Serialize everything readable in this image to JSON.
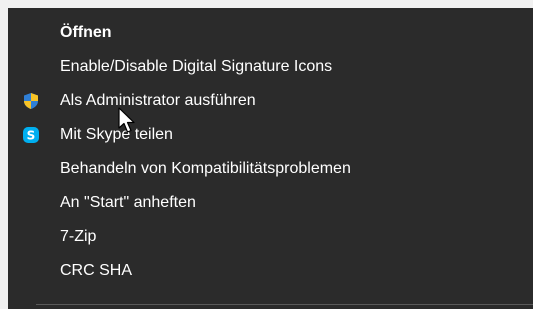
{
  "colors": {
    "menu_bg": "#2b2b2b",
    "hover_bg": "#414141",
    "text": "#ffffff",
    "separator": "#5a5a5a",
    "skype_blue": "#00aff0",
    "shield_yellow": "#f7c325",
    "shield_blue": "#2f7fd6"
  },
  "menu": {
    "items": [
      {
        "label": "Öffnen",
        "icon": ""
      },
      {
        "label": "Enable/Disable Digital Signature Icons",
        "icon": ""
      },
      {
        "label": "Als Administrator ausführen",
        "icon": "uac-shield-icon"
      },
      {
        "label": "Mit Skype teilen",
        "icon": "skype-icon"
      },
      {
        "label": "Behandeln von Kompatibilitätsproblemen",
        "icon": ""
      },
      {
        "label": "An \"Start\" anheften",
        "icon": ""
      },
      {
        "label": "7-Zip",
        "icon": ""
      },
      {
        "label": "CRC SHA",
        "icon": ""
      }
    ]
  }
}
